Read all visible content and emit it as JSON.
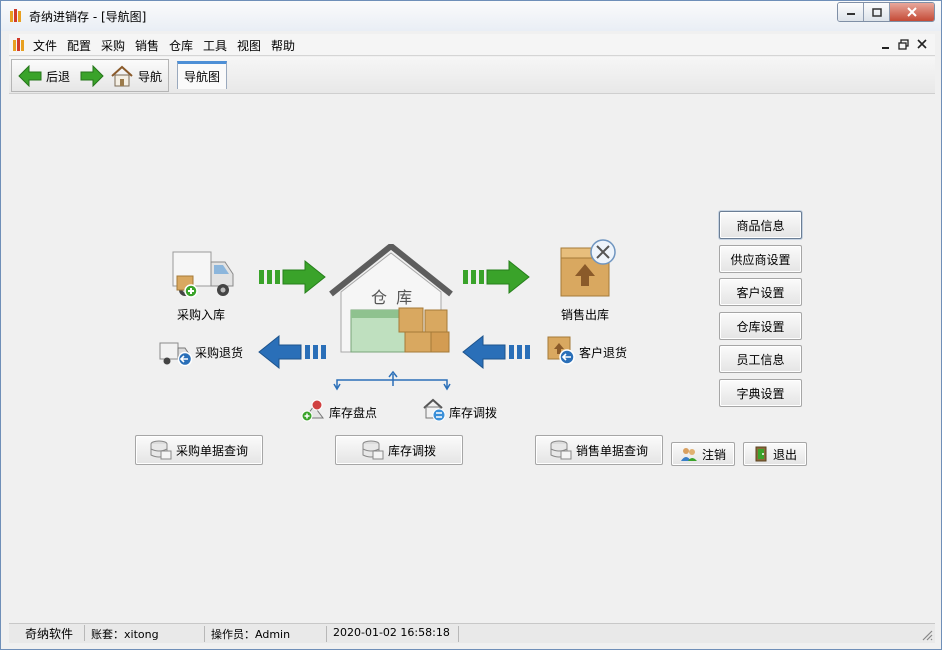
{
  "window": {
    "title": "奇纳进销存 - [导航图]"
  },
  "menu": [
    "文件",
    "配置",
    "采购",
    "销售",
    "仓库",
    "工具",
    "视图",
    "帮助"
  ],
  "toolbar": {
    "back_label": "后退",
    "home_label": "导航"
  },
  "tabs": [
    {
      "label": "导航图",
      "active": true
    }
  ],
  "diagram": {
    "warehouse_label": "仓 库",
    "purchase_in": "采购入库",
    "purchase_return": "采购退货",
    "sales_out": "销售出库",
    "customer_return": "客户退货",
    "stock_count": "库存盘点",
    "stock_transfer": "库存调拨"
  },
  "query_buttons": {
    "purchase_query": "采购单据查询",
    "stock_transfer": "库存调拨",
    "sales_query": "销售单据查询"
  },
  "settings_buttons": [
    "商品信息",
    "供应商设置",
    "客户设置",
    "仓库设置",
    "员工信息",
    "字典设置"
  ],
  "account_buttons": {
    "logout": "注销",
    "exit": "退出"
  },
  "status": {
    "company": "奇纳软件",
    "account_label": "账套：",
    "account_value": "xitong",
    "operator_label": "操作员：",
    "operator_value": "Admin",
    "datetime": "2020-01-02 16:58:18"
  },
  "colors": {
    "green_arrow": "#3aa32a",
    "blue_arrow": "#2a6fb8",
    "tab_accent": "#4d8fd6"
  }
}
